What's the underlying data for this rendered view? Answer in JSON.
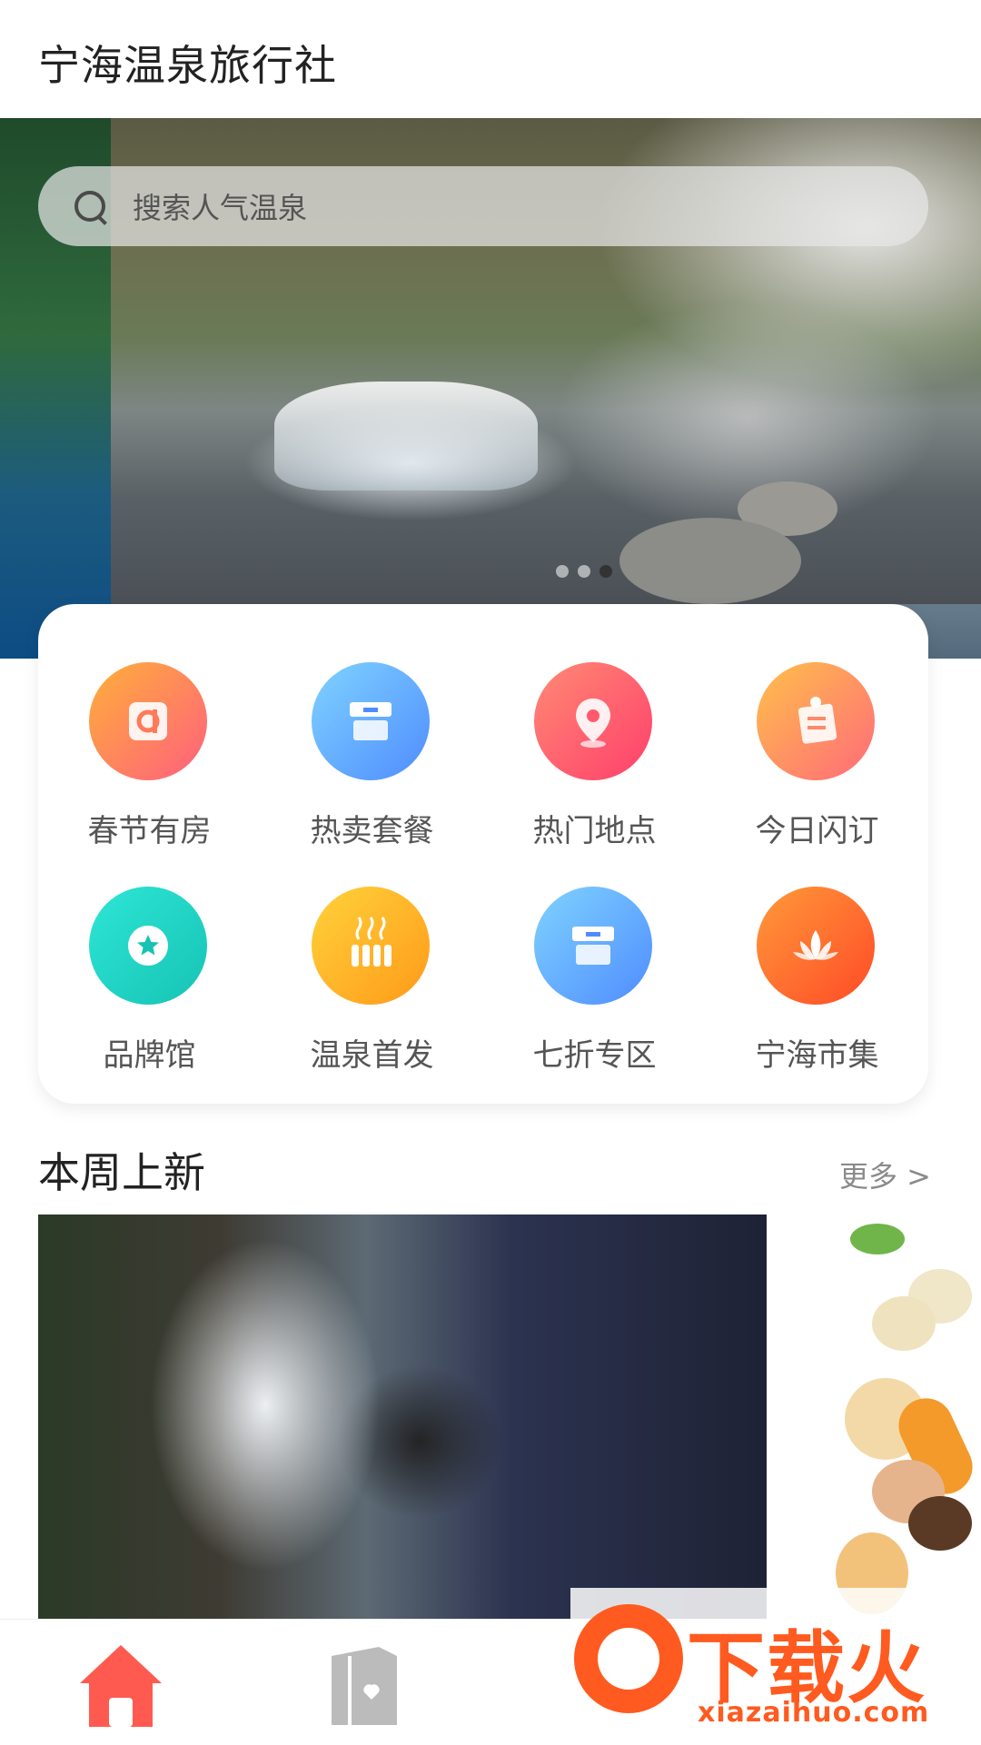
{
  "header": {
    "title": "宁海温泉旅行社"
  },
  "search": {
    "placeholder": "搜索人气温泉",
    "icon": "search-icon"
  },
  "banner": {
    "slide_count": 3,
    "active_index": 2
  },
  "categories": [
    {
      "label": "春节有房",
      "icon": "house-card-icon",
      "color_from": "#ffb03a",
      "color_to": "#ff5f7e"
    },
    {
      "label": "热卖套餐",
      "icon": "box-icon",
      "color_from": "#7fd3ff",
      "color_to": "#4f8cff"
    },
    {
      "label": "热门地点",
      "icon": "location-pin-icon",
      "color_from": "#ff8a73",
      "color_to": "#ff3f6c"
    },
    {
      "label": "今日闪订",
      "icon": "memo-pin-icon",
      "color_from": "#ffc04a",
      "color_to": "#ff6a7a"
    },
    {
      "label": "品牌馆",
      "icon": "star-badge-icon",
      "color_from": "#2ee6d6",
      "color_to": "#16c3b4"
    },
    {
      "label": "温泉首发",
      "icon": "hot-spring-icon",
      "color_from": "#ffd23a",
      "color_to": "#ff9a1a"
    },
    {
      "label": "七折专区",
      "icon": "box-icon",
      "color_from": "#7fd3ff",
      "color_to": "#4f8cff"
    },
    {
      "label": "宁海市集",
      "icon": "lotus-icon",
      "color_from": "#ff9a3a",
      "color_to": "#ff4a26"
    }
  ],
  "section": {
    "title": "本周上新",
    "more": "更多 >"
  },
  "bottom_nav": [
    {
      "icon": "home-icon",
      "active": true,
      "color": "#ff5a4f"
    },
    {
      "icon": "bookmark-card-icon",
      "active": false,
      "color": "#bbbbbb"
    }
  ],
  "watermark": {
    "text": "下载火",
    "url": "xiazaihuo.com"
  }
}
